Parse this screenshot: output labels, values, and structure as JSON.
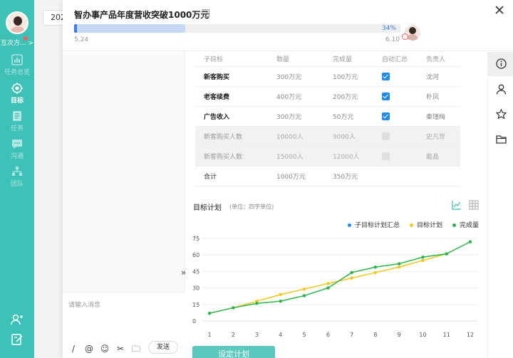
{
  "sidebar": {
    "user_name": "互次方...",
    "items": [
      {
        "label": "任务总览",
        "icon": "dashboard-icon"
      },
      {
        "label": "目标",
        "icon": "target-icon"
      },
      {
        "label": "任务",
        "icon": "task-icon"
      },
      {
        "label": "沟通",
        "icon": "chat-icon"
      },
      {
        "label": "团队",
        "icon": "team-icon"
      }
    ],
    "bottom_icons": [
      "add-user-icon",
      "edit-note-icon"
    ]
  },
  "background": {
    "year_text": "202"
  },
  "header": {
    "title": "智办事产品年度营收突破1000万元",
    "progress": {
      "percent": 34,
      "label": "34%"
    },
    "start_date": "5.24",
    "end_date": "6.10"
  },
  "chat": {
    "placeholder": "请输入消息",
    "send_label": "发送",
    "tools": [
      "/",
      "@",
      "☺",
      "✂",
      "🗀"
    ]
  },
  "table": {
    "headers": [
      "子目标",
      "数量",
      "完成量",
      "自动汇总",
      "负责人"
    ],
    "rows": [
      {
        "name": "新客购买",
        "qty": "300万元",
        "done": "100万元",
        "auto": true,
        "owner": "沈河",
        "sub": false
      },
      {
        "name": "老客续费",
        "qty": "400万元",
        "done": "200万元",
        "auto": true,
        "owner": "朴凤",
        "sub": false
      },
      {
        "name": "广告收入",
        "qty": "300万元",
        "done": "50万元",
        "auto": true,
        "owner": "秦瑾梅",
        "sub": false
      },
      {
        "name": "新客购买人数",
        "qty": "10000人",
        "done": "9000人",
        "auto": false,
        "owner": "史凡世",
        "sub": true
      },
      {
        "name": "新客购买人数",
        "qty": "15000人",
        "done": "12000人",
        "auto": false,
        "owner": "戴晶",
        "sub": true
      }
    ],
    "total": {
      "name": "合计",
      "qty": "1000万元",
      "done": "350万元"
    }
  },
  "plan": {
    "title": "目标计划",
    "unit": "(单位：四字单位)",
    "button_label": "设定计划"
  },
  "chart_data": {
    "type": "line",
    "x": [
      1,
      2,
      3,
      4,
      5,
      6,
      7,
      8,
      9,
      10,
      11,
      12
    ],
    "ylim": [
      0,
      75
    ],
    "yticks": [
      0,
      15,
      30,
      45,
      60,
      75
    ],
    "grid": true,
    "legend_position": "top-right",
    "series": [
      {
        "name": "子目标计划汇总",
        "color": "#1e8bf0",
        "values": []
      },
      {
        "name": "目标计划",
        "color": "#f5c518",
        "values": [
          7,
          12,
          18,
          24,
          29,
          34,
          39,
          44,
          49,
          55,
          61,
          null
        ]
      },
      {
        "name": "完成量",
        "color": "#27b648",
        "values": [
          7,
          12,
          16,
          18,
          23,
          30,
          44,
          49,
          52,
          58,
          61,
          72
        ]
      }
    ]
  },
  "tools": [
    "info-icon",
    "user-icon",
    "star-icon",
    "folder-icon"
  ]
}
